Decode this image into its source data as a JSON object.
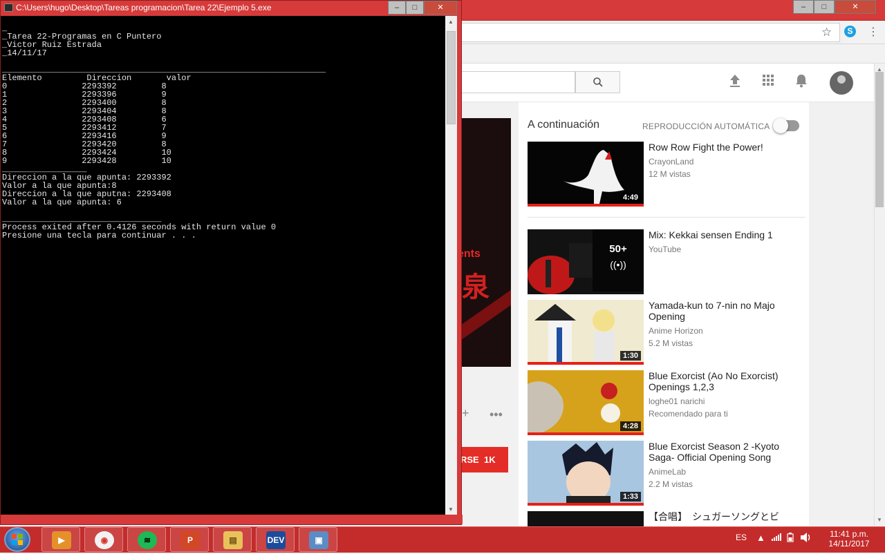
{
  "console": {
    "title": "C:\\Users\\hugo\\Desktop\\Tareas programacion\\Tarea 22\\Ejemplo 5.exe",
    "lines": [
      "_",
      "_Tarea 22-Programas en C Puntero",
      "_Victor Ruiz Estrada",
      "_14/11/17",
      "",
      "_________________________________________________________________",
      "Elemento         Direccion       valor",
      "0               2293392         8",
      "1               2293396         9",
      "2               2293400         8",
      "3               2293404         8",
      "4               2293408         6",
      "5               2293412         7",
      "6               2293416         9",
      "7               2293420         8",
      "8               2293424         10",
      "9               2293428         10",
      "_________________",
      "Direccion a la que apunta: 2293392",
      "Valor a la que apunta:8",
      "Direccion a la que aputna: 2293408",
      "Valor a la que apunta: 6",
      "",
      "________________________________",
      "Process exited after 0.4126 seconds with return value 0",
      "Presione una tecla para continuar . . ."
    ],
    "buttons": {
      "minimize": "–",
      "maximize": "□",
      "close": "✕"
    }
  },
  "chrome": {
    "buttons": {
      "minimize": "–",
      "maximize": "□",
      "close": "✕"
    },
    "star_icon": "star-icon",
    "skype_icon": "skype-icon"
  },
  "youtube": {
    "search_icon": "search-icon",
    "upnext_label": "A continuación",
    "autoplay_label": "REPRODUCCIÓN AUTOMÁTICA",
    "subscribe_label": "RSE",
    "subscribe_count": "1K",
    "player_text": "ents",
    "player_kanji": "泉",
    "videos": [
      {
        "title": "Row Row Fight the Power!",
        "channel": "CrayonLand",
        "meta": "12 M vistas",
        "duration": "4:49"
      },
      {
        "title": "Mix: Kekkai sensen Ending 1",
        "channel": "YouTube",
        "meta": "",
        "duration": "",
        "mix_count": "50+",
        "mix_icon": "((•))"
      },
      {
        "title": "Yamada-kun to 7-nin no Majo Opening",
        "channel": "Anime Horizon",
        "meta": "5.2 M vistas",
        "duration": "1:30"
      },
      {
        "title": "Blue Exorcist (Ao No Exorcist) Openings 1,2,3",
        "channel": "loghe01 narichi",
        "meta": "Recomendado para ti",
        "duration": "4:28"
      },
      {
        "title": "Blue Exorcist Season 2 -Kyoto Saga- Official Opening Song",
        "channel": "AnimeLab",
        "meta": "2.2 M vistas",
        "duration": "1:33"
      },
      {
        "title": "【合唱】　シュガーソングとビ",
        "channel": "",
        "meta": "",
        "duration": ""
      }
    ]
  },
  "taskbar": {
    "apps": [
      {
        "name": "media-player",
        "label": "▶"
      },
      {
        "name": "chrome",
        "label": "◉"
      },
      {
        "name": "spotify",
        "label": "≋"
      },
      {
        "name": "powerpoint",
        "label": "P"
      },
      {
        "name": "file-explorer",
        "label": "▤"
      },
      {
        "name": "dev-cpp",
        "label": "DEV"
      },
      {
        "name": "console-app",
        "label": "▣"
      }
    ],
    "language": "ES",
    "time": "11:41 p.m.",
    "date": "14/11/2017"
  }
}
